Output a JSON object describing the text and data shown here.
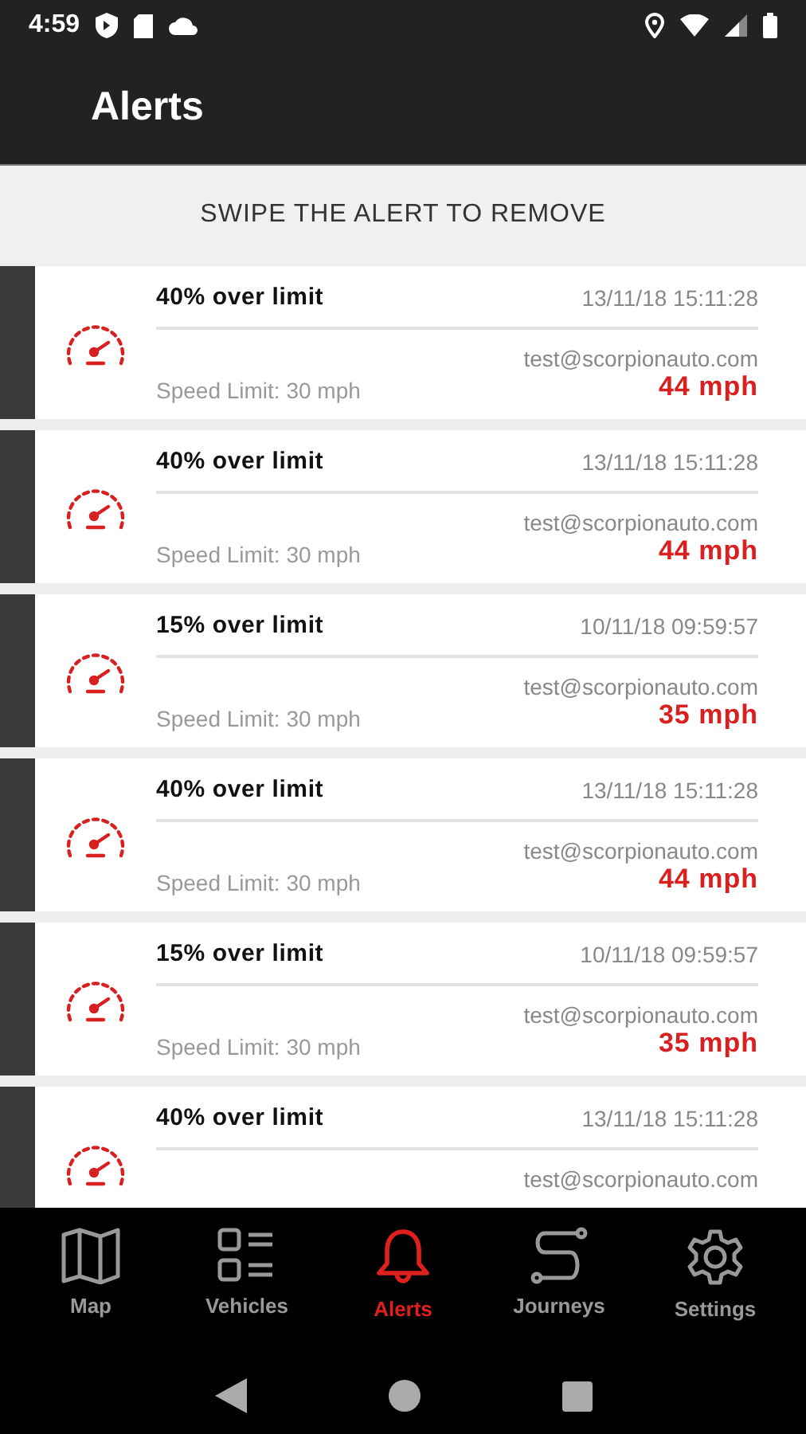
{
  "status_bar": {
    "time": "4:59"
  },
  "app_bar": {
    "title": "Alerts"
  },
  "banner": {
    "text": "SWIPE THE ALERT TO REMOVE"
  },
  "alerts": [
    {
      "title": "40% over limit",
      "time": "13/11/18 15:11:28",
      "email": "test@scorpionauto.com",
      "speed_limit": "Speed Limit: 30 mph",
      "speed": "44 mph"
    },
    {
      "title": "40% over limit",
      "time": "13/11/18 15:11:28",
      "email": "test@scorpionauto.com",
      "speed_limit": "Speed Limit: 30 mph",
      "speed": "44 mph"
    },
    {
      "title": "15% over limit",
      "time": "10/11/18 09:59:57",
      "email": "test@scorpionauto.com",
      "speed_limit": "Speed Limit: 30 mph",
      "speed": "35 mph"
    },
    {
      "title": "40% over limit",
      "time": "13/11/18 15:11:28",
      "email": "test@scorpionauto.com",
      "speed_limit": "Speed Limit: 30 mph",
      "speed": "44 mph"
    },
    {
      "title": "15% over limit",
      "time": "10/11/18 09:59:57",
      "email": "test@scorpionauto.com",
      "speed_limit": "Speed Limit: 30 mph",
      "speed": "35 mph"
    },
    {
      "title": "40% over limit",
      "time": "13/11/18 15:11:28",
      "email": "test@scorpionauto.com"
    }
  ],
  "bottom_nav": [
    {
      "kind": "map",
      "label": "Map",
      "selected": false
    },
    {
      "kind": "vehicles",
      "label": "Vehicles",
      "selected": false
    },
    {
      "kind": "alerts",
      "label": "Alerts",
      "selected": true
    },
    {
      "kind": "journeys",
      "label": "Journeys",
      "selected": false
    },
    {
      "kind": "settings",
      "label": "Settings",
      "selected": false
    }
  ]
}
